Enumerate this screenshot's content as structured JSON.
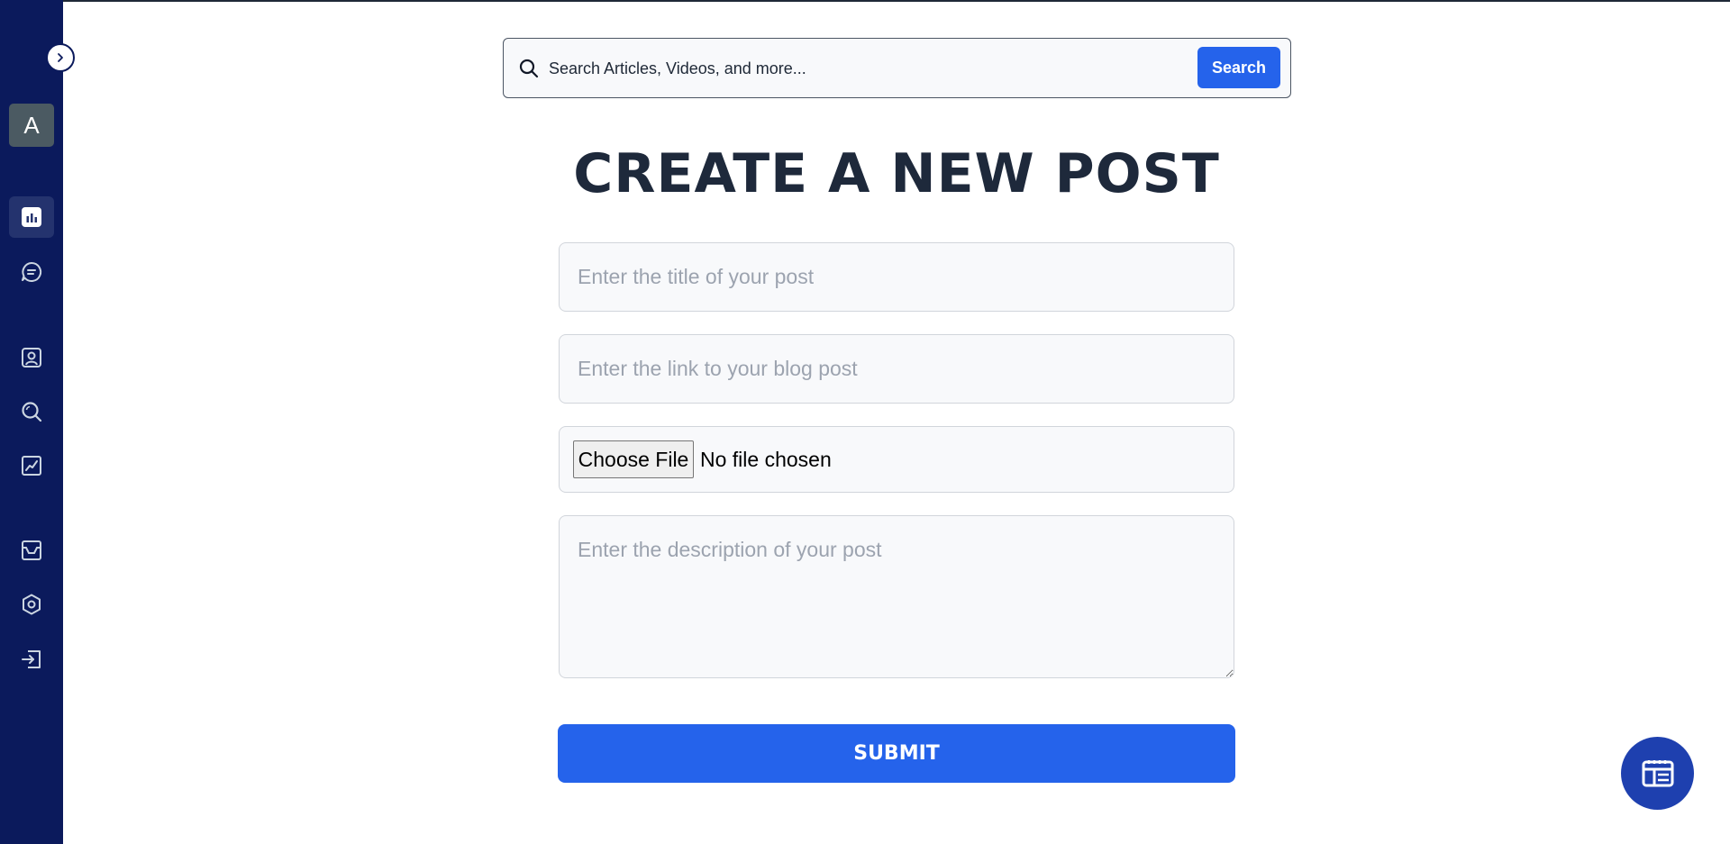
{
  "sidebar": {
    "avatar_letter": "A",
    "items": [
      {
        "name": "dashboard",
        "icon": "bar-chart-icon",
        "active": true
      },
      {
        "name": "messages",
        "icon": "chat-icon",
        "active": false
      },
      {
        "name": "profile",
        "icon": "user-icon",
        "active": false
      },
      {
        "name": "explore",
        "icon": "search-icon",
        "active": false
      },
      {
        "name": "analytics",
        "icon": "line-chart-icon",
        "active": false
      },
      {
        "name": "inbox",
        "icon": "inbox-icon",
        "active": false
      },
      {
        "name": "settings",
        "icon": "gear-icon",
        "active": false
      },
      {
        "name": "logout",
        "icon": "logout-icon",
        "active": false
      }
    ]
  },
  "search": {
    "placeholder": "Search Articles, Videos, and more...",
    "button_label": "Search"
  },
  "page": {
    "title": "CREATE A NEW POST"
  },
  "form": {
    "title_placeholder": "Enter the title of your post",
    "link_placeholder": "Enter the link to your blog post",
    "file_button_label": "Choose File",
    "file_status": "No file chosen",
    "description_placeholder": "Enter the description of your post",
    "submit_label": "SUBMIT"
  },
  "fab": {
    "icon": "layout-icon"
  },
  "colors": {
    "sidebar": "#0b1a5c",
    "accent": "#2563eb",
    "title": "#1e293b",
    "fab": "#1e40af"
  }
}
